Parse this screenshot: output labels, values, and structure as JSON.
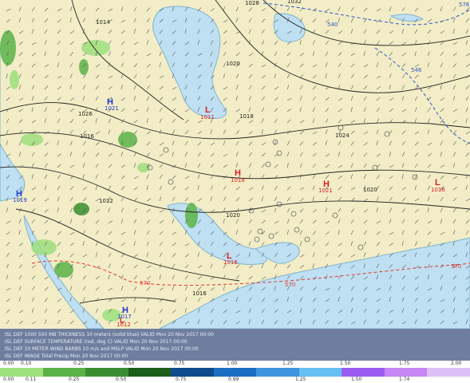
{
  "map": {
    "colors": {
      "land": "#f2edc6",
      "water": "#bfe0f2",
      "coast": "#7fb3d0",
      "isobar": "#222222",
      "isotherm": "#e3342f",
      "thickness_blue": "#2e55c7",
      "high_low_red": "#d81e1e",
      "high_low_blue": "#1f39c9"
    },
    "systems": [
      {
        "symbol": "H",
        "value": "1021",
        "color": "blue"
      },
      {
        "symbol": "L",
        "value": "1011",
        "color": "red"
      },
      {
        "symbol": "H",
        "value": "1018",
        "color": "red"
      },
      {
        "symbol": "H",
        "value": "1021",
        "color": "red"
      },
      {
        "symbol": "H",
        "value": "1019",
        "color": "blue"
      },
      {
        "symbol": "L",
        "value": "1016",
        "color": "red"
      },
      {
        "symbol": "H",
        "value": "1017",
        "color": "blue"
      },
      {
        "symbol": "L",
        "value": "1016",
        "color": "red"
      },
      {
        "symbol": "L",
        "value": "1012",
        "color": "red"
      }
    ],
    "isobar_labels": [
      "1012",
      "1014",
      "1016",
      "1016",
      "1018",
      "1020",
      "1020",
      "1020",
      "1024",
      "1026",
      "1028",
      "1032"
    ],
    "thickness_labels": [
      "540",
      "546",
      "570",
      "570",
      "570",
      "576"
    ]
  },
  "legend": {
    "lines": [
      "ISL DEF 1000 500 MB THICKNESS 10 meters (solid blue) VALID Mon 20 Nov 2017 00:00",
      "ISL DEF SURFACE TEMPERATURE (red, deg C) VALID Mon 20 Nov 2017 00:00",
      "ISL DEF 10 METER WIND BARBS 10 m/s and MSLP VALID Mon 20 Nov 2017 00:00",
      "ISL DEF IMAGE Total Precip Mon 20 Nov 2017 00:00"
    ]
  },
  "colorbar": {
    "top_ticks": [
      "0.00",
      "0.10",
      "0.25",
      "0.50",
      "0.75",
      "1.00",
      "1.25",
      "1.50",
      "1.75",
      "2.00"
    ],
    "bottom_ticks": [
      "0.00",
      "0.11",
      "0.25",
      "0.50",
      "0.75",
      "0.99",
      "1.25",
      "1.50",
      "1.74"
    ],
    "bins": [
      "#9ee07e",
      "#5bb348",
      "#3a8e30",
      "#1d5e1a",
      "#0e4a8c",
      "#1c6ec3",
      "#3d95e0",
      "#67c0f1",
      "#9b5cf2",
      "#c686f3",
      "#dcc1f7"
    ]
  }
}
